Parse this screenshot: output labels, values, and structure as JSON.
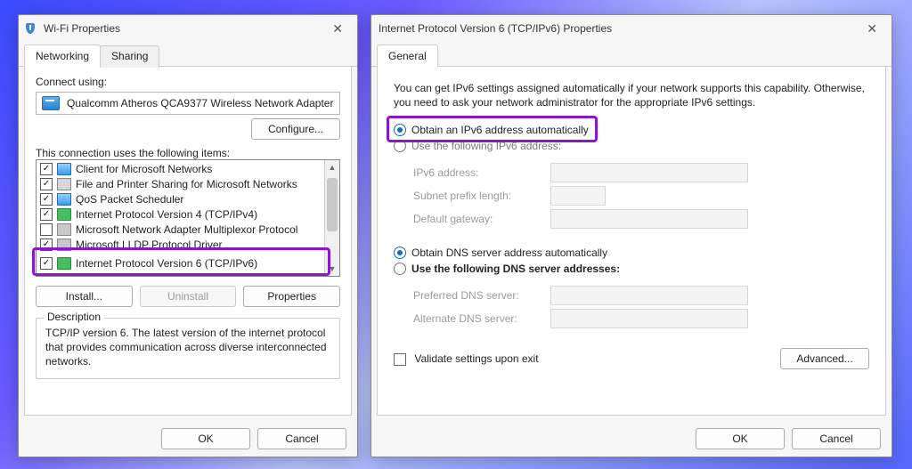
{
  "wifi": {
    "title": "Wi-Fi Properties",
    "tabs": {
      "networking": "Networking",
      "sharing": "Sharing"
    },
    "connect_using": "Connect using:",
    "adapter": "Qualcomm Atheros QCA9377 Wireless Network Adapter",
    "configure": "Configure...",
    "items_label": "This connection uses the following items:",
    "items": [
      {
        "checked": true,
        "icon": "pi-monitor",
        "label": "Client for Microsoft Networks"
      },
      {
        "checked": true,
        "icon": "pi-printer",
        "label": "File and Printer Sharing for Microsoft Networks"
      },
      {
        "checked": true,
        "icon": "pi-monitor",
        "label": "QoS Packet Scheduler"
      },
      {
        "checked": true,
        "icon": "pi-net",
        "label": "Internet Protocol Version 4 (TCP/IPv4)"
      },
      {
        "checked": false,
        "icon": "pi-gray",
        "label": "Microsoft Network Adapter Multiplexor Protocol"
      },
      {
        "checked": true,
        "icon": "pi-gray",
        "label": "Microsoft LLDP Protocol Driver"
      },
      {
        "checked": true,
        "icon": "pi-net",
        "label": "Internet Protocol Version 6 (TCP/IPv6)"
      }
    ],
    "install": "Install...",
    "uninstall": "Uninstall",
    "properties": "Properties",
    "description_title": "Description",
    "description": "TCP/IP version 6. The latest version of the internet protocol that provides communication across diverse interconnected networks.",
    "ok": "OK",
    "cancel": "Cancel"
  },
  "ipv6": {
    "title": "Internet Protocol Version 6 (TCP/IPv6) Properties",
    "tab_general": "General",
    "info": "You can get IPv6 settings assigned automatically if your network supports this capability. Otherwise, you need to ask your network administrator for the appropriate IPv6 settings.",
    "r_auto_addr": "Obtain an IPv6 address automatically",
    "r_use_addr": "Use the following IPv6 address:",
    "f_ipv6": "IPv6 address:",
    "f_prefix": "Subnet prefix length:",
    "f_gateway": "Default gateway:",
    "r_auto_dns": "Obtain DNS server address automatically",
    "r_use_dns": "Use the following DNS server addresses:",
    "f_pref_dns": "Preferred DNS server:",
    "f_alt_dns": "Alternate DNS server:",
    "validate": "Validate settings upon exit",
    "advanced": "Advanced...",
    "ok": "OK",
    "cancel": "Cancel"
  }
}
